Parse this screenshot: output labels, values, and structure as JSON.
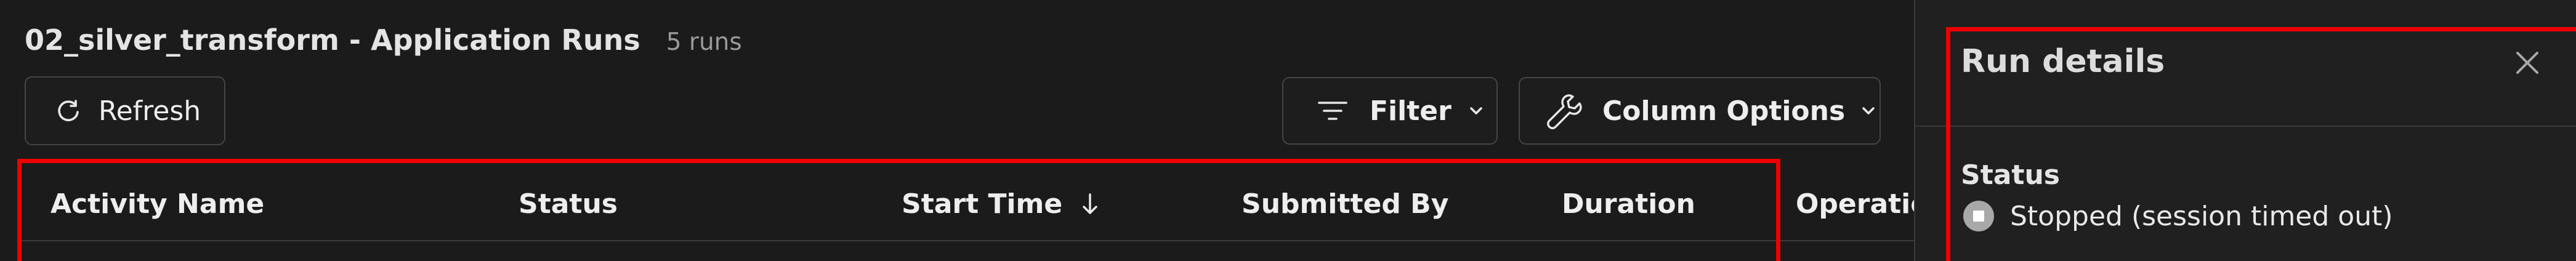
{
  "page": {
    "title": "02_silver_transform - Application Runs",
    "run_count": "5 runs"
  },
  "toolbar": {
    "refresh_label": "Refresh",
    "filter_label": "Filter",
    "column_options_label": "Column Options"
  },
  "table": {
    "columns": [
      {
        "label": "Activity Name"
      },
      {
        "label": "Status"
      },
      {
        "label": "Start Time",
        "sort": "descending"
      },
      {
        "label": "Submitted By"
      },
      {
        "label": "Duration"
      },
      {
        "label": "Operation"
      }
    ]
  },
  "run_details": {
    "title": "Run details",
    "status_label": "Status",
    "status_value": "Stopped (session timed out)"
  },
  "icons": {
    "refresh": "refresh-icon",
    "filter": "filter-icon",
    "column_options": "wrench-icon",
    "dropdown": "chevron-down-icon",
    "sort": "arrow-down-icon",
    "close": "close-icon",
    "status": "stopped-icon"
  },
  "colors": {
    "background": "#1b1b1b",
    "panel": "#202020",
    "border": "#454545",
    "text": "#e9e9e9",
    "muted_text": "#9a9a9a",
    "annotation": "#ee0000",
    "status_icon": "#a8a8a8"
  }
}
